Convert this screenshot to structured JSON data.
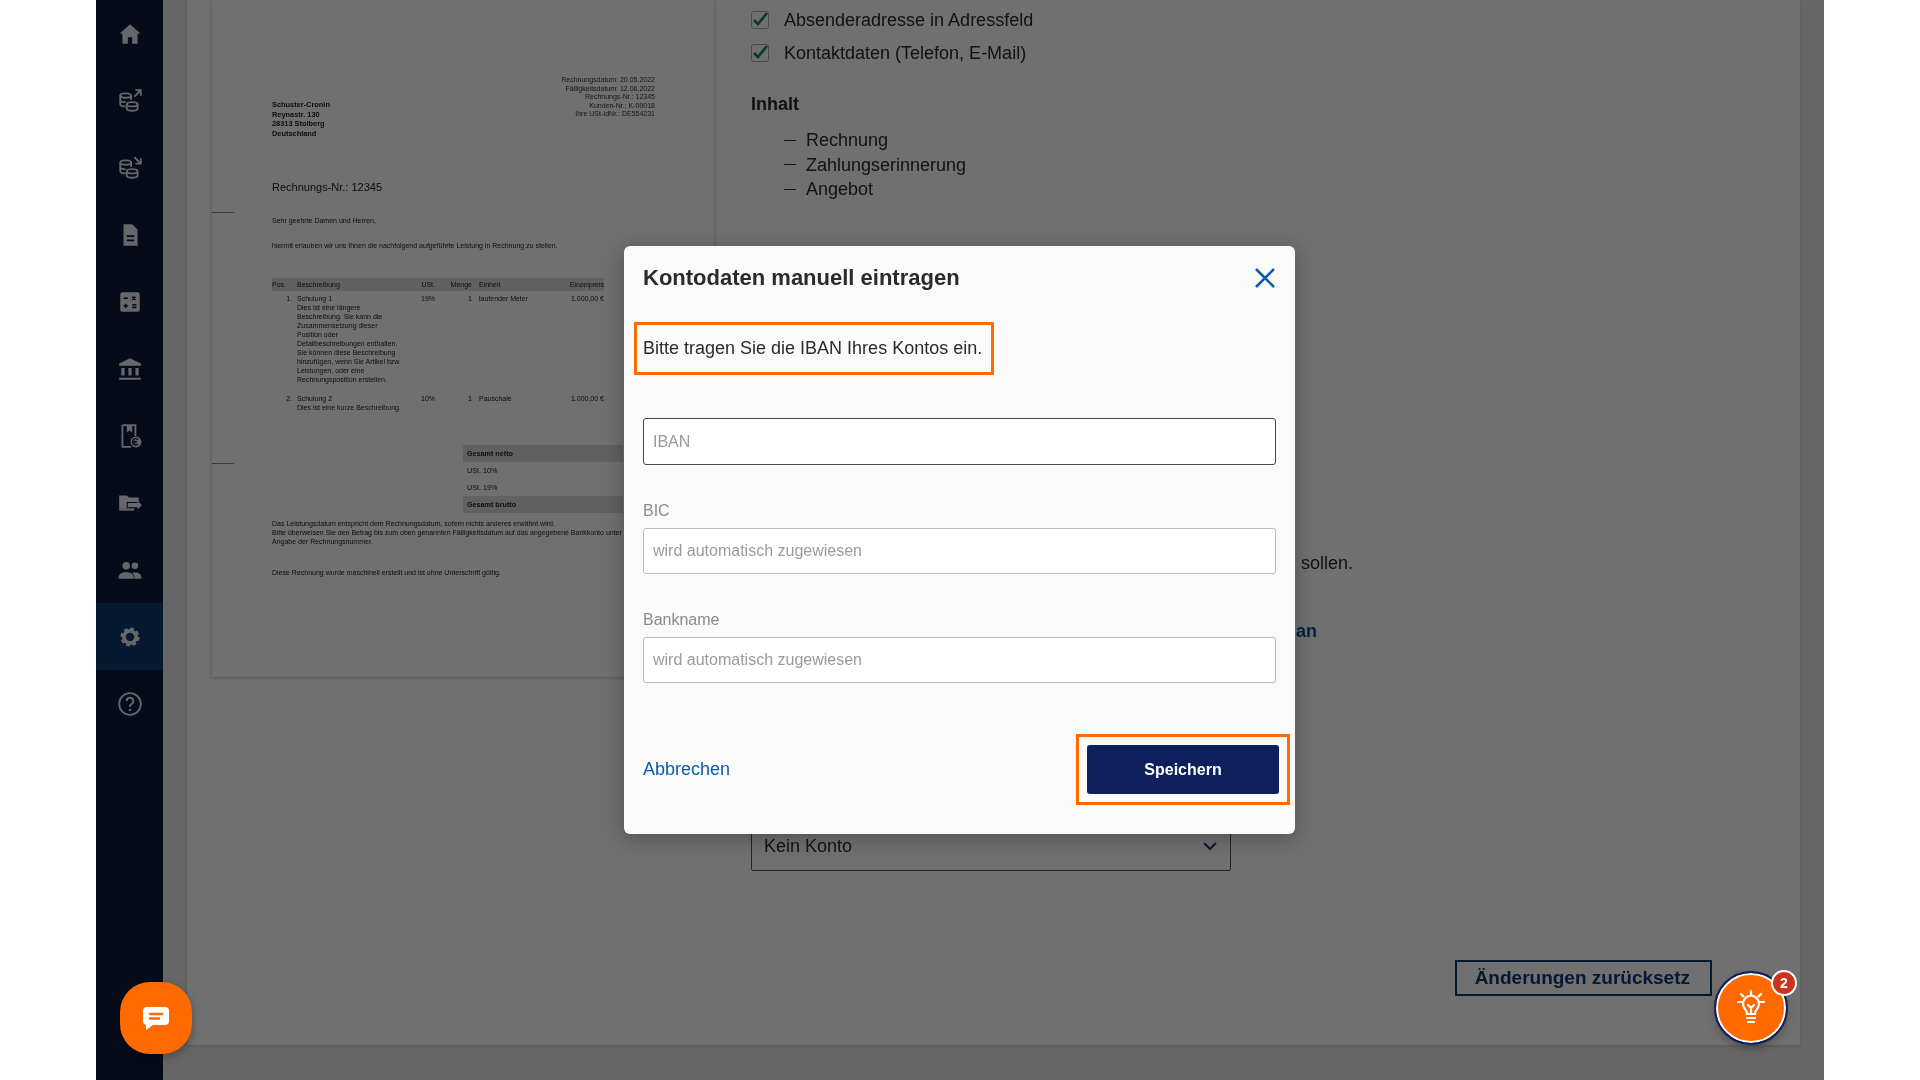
{
  "sidebar": {
    "items": [
      {
        "kind": "home",
        "selected": false
      },
      {
        "kind": "coins-out",
        "selected": false
      },
      {
        "kind": "coins-in",
        "selected": false
      },
      {
        "kind": "document",
        "selected": false
      },
      {
        "kind": "calculator",
        "selected": false
      },
      {
        "kind": "bank",
        "selected": false
      },
      {
        "kind": "receipt",
        "selected": false
      },
      {
        "kind": "folder",
        "selected": false
      },
      {
        "kind": "people",
        "selected": false
      },
      {
        "kind": "settings",
        "selected": true
      },
      {
        "kind": "help",
        "selected": false
      }
    ]
  },
  "invoice_preview": {
    "meta": [
      "Rechnungsdatum: 20.05.2022",
      "Fälligkeitsdatum: 12.06.2022",
      "Rechnungs-Nr.: 12345",
      "Kunden-Nr.: K-00018",
      "Ihre USt-IdNr.: DE554231"
    ],
    "sender": [
      "Schuster-Cronin",
      "Reynastr. 130",
      "28313 Stolberg",
      "Deutschland"
    ],
    "title": "Rechnungs-Nr.: 12345",
    "greeting": "Sehr geehrte Damen und Herren,",
    "intro": "hiermit erlauben wir uns Ihnen die nachfolgend aufgeführte Leistung in Rechnung zu stellen.",
    "table": {
      "columns": [
        "Pos.",
        "Beschreibung",
        "USt.",
        "Menge",
        "Einheit",
        "Einzelpreis"
      ],
      "rows": [
        {
          "cells": [
            "1.",
            "Schulung 1",
            "19%",
            "1",
            "laufender Meter",
            "1.000,00 €"
          ],
          "description": "Dies ist eine längere Beschreibung. Sie kann die Zusammensetzung dieser Position oder Detailbeschreibungen enthalten. Sie können diese Beschreibung hinzufügen, wenn Sie Artikel bzw. Leistungen, oder eine Rechnungsposition erstellen."
        },
        {
          "cells": [
            "2.",
            "Schulung 2",
            "10%",
            "1",
            "Pauschale",
            "1.000,00 €"
          ],
          "description": "Dies ist eine kurze Beschreibung."
        }
      ]
    },
    "totals": [
      {
        "label": "Gesamt netto",
        "kind": "sum"
      },
      {
        "label": "USt. 10%",
        "kind": "tax"
      },
      {
        "label": "USt. 19%",
        "kind": "tax"
      },
      {
        "label": "Gesamt brutto",
        "kind": "sum"
      }
    ],
    "notes": [
      "Das Leistungsdatum entspricht dem Rechnungsdatum, sofern nichts anderes erwähnt wird.",
      "Bitte überweisen Sie den Betrag bis zum oben genannten Fälligkeitsdatum auf das angegebene Bankkonto unter Angabe der Rechnungsnummer."
    ],
    "closing": "Diese Rechnung wurde maschinell erstellt und ist ohne Unterschrift gültig."
  },
  "settings": {
    "checkboxes": [
      {
        "label": "Absenderadresse in Adressfeld",
        "checked": true
      },
      {
        "label": "Kontaktdaten (Telefon, E-Mail)",
        "checked": true
      }
    ],
    "content_heading": "Inhalt",
    "content_items": [
      "Rechnung",
      "Zahlungserinnerung",
      "Angebot"
    ],
    "text_fragment": "sollen.",
    "link_fragment": "an",
    "account_select": {
      "value": "Kein Konto"
    },
    "reset_button": "Änderungen zurücksetz"
  },
  "tips_button": {
    "badge": "2"
  },
  "dialog": {
    "title": "Kontodaten manuell eintragen",
    "instruction": "Bitte tragen Sie die IBAN Ihres Kontos ein.",
    "instruction_highlighted": true,
    "fields": [
      {
        "placeholder": "IBAN",
        "focused": true
      },
      {
        "label": "BIC",
        "placeholder": "wird automatisch zugewiesen",
        "focused": false
      },
      {
        "label": "Bankname",
        "placeholder": "wird automatisch zugewiesen",
        "focused": false
      }
    ],
    "cancel": "Abbrechen",
    "save": "Speichern",
    "save_highlighted": true
  }
}
